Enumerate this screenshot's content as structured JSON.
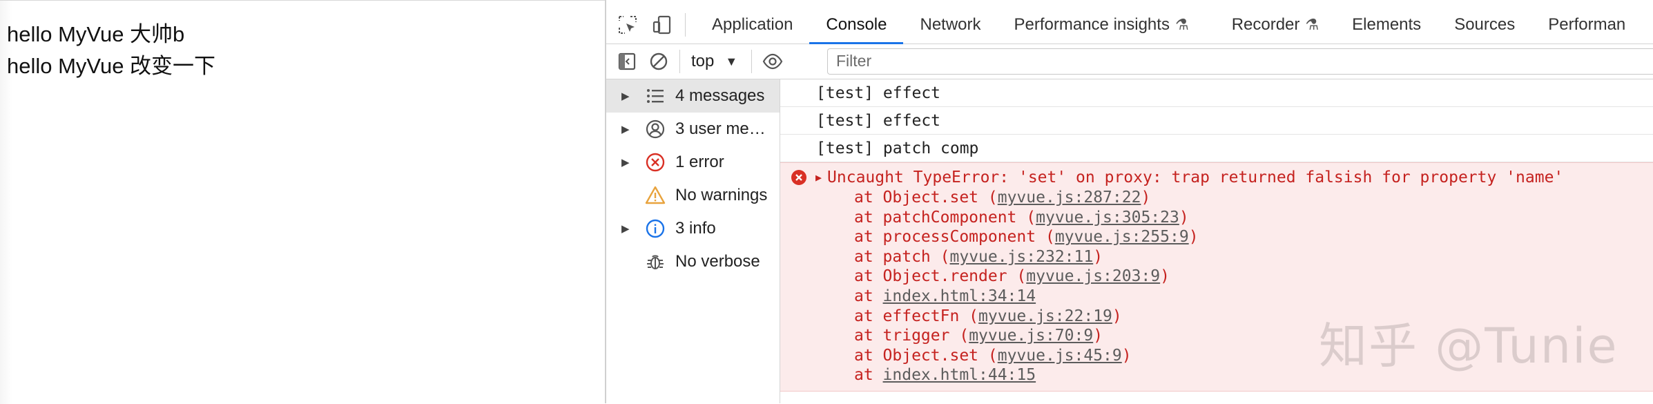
{
  "page": {
    "lines": [
      "hello MyVue 大帅b",
      "hello MyVue 改变一下"
    ]
  },
  "devtools": {
    "tabs": [
      {
        "label": "Application",
        "active": false,
        "experimental": false
      },
      {
        "label": "Console",
        "active": true,
        "experimental": false
      },
      {
        "label": "Network",
        "active": false,
        "experimental": false
      },
      {
        "label": "Performance insights",
        "active": false,
        "experimental": true
      },
      {
        "label": "Recorder",
        "active": false,
        "experimental": true
      },
      {
        "label": "Elements",
        "active": false,
        "experimental": false
      },
      {
        "label": "Sources",
        "active": false,
        "experimental": false
      },
      {
        "label": "Performan",
        "active": false,
        "experimental": false
      }
    ],
    "toolbar": {
      "context": "top",
      "filter_placeholder": "Filter"
    },
    "sidebar": [
      {
        "label": "4 messages",
        "icon": "list-icon",
        "selected": true,
        "expandable": true
      },
      {
        "label": "3 user me…",
        "icon": "user-icon",
        "selected": false,
        "expandable": true
      },
      {
        "label": "1 error",
        "icon": "error-icon",
        "selected": false,
        "expandable": true
      },
      {
        "label": "No warnings",
        "icon": "warning-icon",
        "selected": false,
        "expandable": false
      },
      {
        "label": "3 info",
        "icon": "info-icon",
        "selected": false,
        "expandable": true
      },
      {
        "label": "No verbose",
        "icon": "bug-icon",
        "selected": false,
        "expandable": false
      }
    ],
    "log": [
      "[test] effect",
      "[test] effect",
      "[test] patch comp"
    ],
    "error": {
      "message": "Uncaught TypeError: 'set' on proxy: trap returned falsish for property 'name'",
      "frames": [
        {
          "fn": "Object.set",
          "loc": "myvue.js:287:22"
        },
        {
          "fn": "patchComponent",
          "loc": "myvue.js:305:23"
        },
        {
          "fn": "processComponent",
          "loc": "myvue.js:255:9"
        },
        {
          "fn": "patch",
          "loc": "myvue.js:232:11"
        },
        {
          "fn": "Object.render",
          "loc": "myvue.js:203:9"
        },
        {
          "fn": "",
          "loc": "index.html:34:14"
        },
        {
          "fn": "effectFn",
          "loc": "myvue.js:22:19"
        },
        {
          "fn": "trigger",
          "loc": "myvue.js:70:9"
        },
        {
          "fn": "Object.set",
          "loc": "myvue.js:45:9"
        },
        {
          "fn": "",
          "loc": "index.html:44:15"
        }
      ]
    }
  },
  "watermark": "知乎 @Tunie",
  "colors": {
    "accent": "#1a73e8",
    "error_text": "#c5221f",
    "error_bg": "#fcebeb",
    "warning": "#e8a33d",
    "info": "#1a73e8"
  }
}
